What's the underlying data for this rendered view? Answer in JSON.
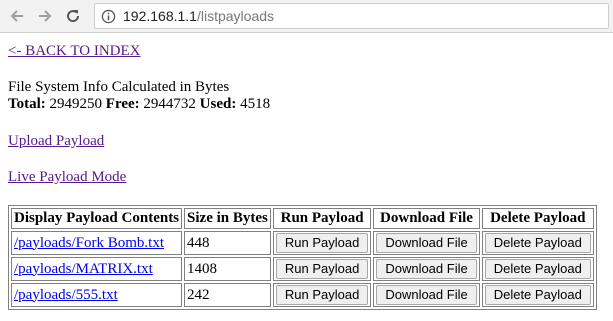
{
  "browser": {
    "url_host": "192.168.1.1",
    "url_path": "/listpayloads"
  },
  "page": {
    "back_link": "<- BACK TO INDEX",
    "fs_heading": "File System Info Calculated in Bytes",
    "total_label": "Total:",
    "total_value": "2949250",
    "free_label": "Free:",
    "free_value": "2944732",
    "used_label": "Used:",
    "used_value": "4518",
    "upload_link": "Upload Payload",
    "live_link": "Live Payload Mode"
  },
  "table": {
    "headers": [
      "Display Payload Contents",
      "Size in Bytes",
      "Run Payload",
      "Download File",
      "Delete Payload"
    ],
    "rows": [
      {
        "path": "/payloads/Fork Bomb.txt",
        "size": "448",
        "run": "Run Payload",
        "download": "Download File",
        "delete": "Delete Payload"
      },
      {
        "path": "/payloads/MATRIX.txt",
        "size": "1408",
        "run": "Run Payload",
        "download": "Download File",
        "delete": "Delete Payload"
      },
      {
        "path": "/payloads/555.txt",
        "size": "242",
        "run": "Run Payload",
        "download": "Download File",
        "delete": "Delete Payload"
      }
    ]
  }
}
